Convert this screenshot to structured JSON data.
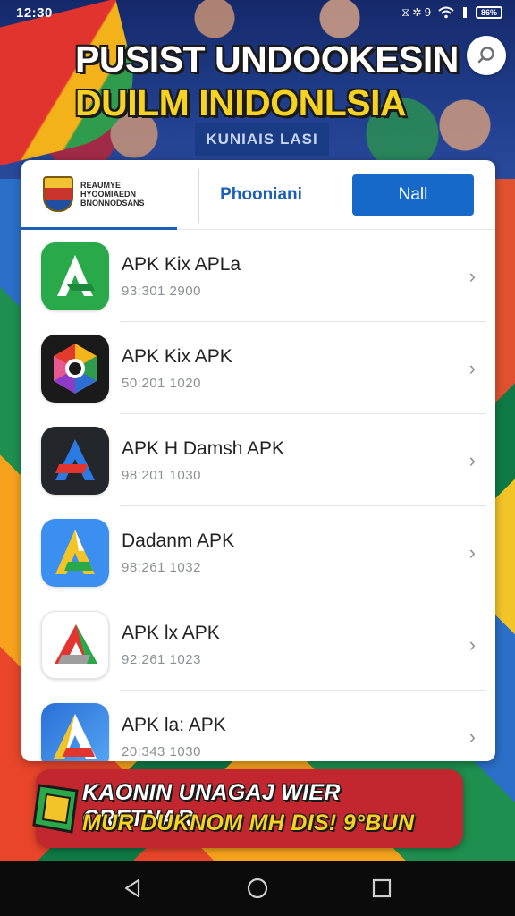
{
  "status_bar": {
    "time": "12:30",
    "indicators": "⧖ ✲ 9",
    "battery": "86%",
    "icons": [
      "sync-icon",
      "alarm-icon",
      "wifi-icon",
      "signal-icon",
      "battery-icon"
    ]
  },
  "hero": {
    "headline_line1": "PUSIST UNDOOKESIN",
    "headline_line2": "DUILM INIDONLSIA",
    "signboard": "KUNIAIS LASI",
    "colors": {
      "line1": "#ffffff",
      "line2": "#f6d322",
      "swoosh": "#e1342e"
    }
  },
  "search_button": {
    "icon": "search-icon"
  },
  "card": {
    "brand": {
      "line1": "REAUMYE",
      "line2": "HYOOMIAEDN",
      "line3": "BNONNODSANS"
    },
    "tab_link": "Phooniani",
    "primary_button": "Nall",
    "apps": [
      {
        "title": "APK Kix APLa",
        "subtitle": "93:301 2900",
        "icon": "green-a-icon"
      },
      {
        "title": "APK Kix APK",
        "subtitle": "50:201 1020",
        "icon": "chrome-hex-icon"
      },
      {
        "title": "APK H Damsh APK",
        "subtitle": "98:201 1030",
        "icon": "dark-a-icon"
      },
      {
        "title": "Dadanm APK",
        "subtitle": "98:261 1032",
        "icon": "blue-a-icon"
      },
      {
        "title": "APK lx APK",
        "subtitle": "92:261 1023",
        "icon": "red-a-icon"
      },
      {
        "title": "APK la: APK",
        "subtitle": "20:343 1030",
        "icon": "gradient-a-icon"
      }
    ]
  },
  "promo": {
    "line1": "KAONIN UNAGAJ WIER CRETNAR",
    "line2": "MUR DUKNOM MH DIS! 9°BUN",
    "icon": "ticket-icon"
  },
  "nav": {
    "icons": [
      "back-icon",
      "home-icon",
      "recents-icon"
    ]
  }
}
